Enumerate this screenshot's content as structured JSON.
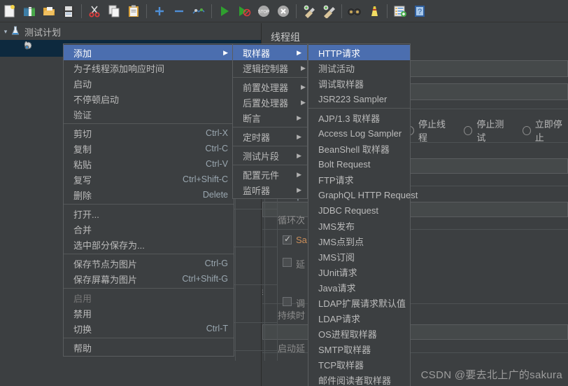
{
  "toolbar": {
    "items": [
      {
        "name": "new-icon",
        "title": "新建"
      },
      {
        "name": "templates-icon",
        "title": "模板"
      },
      {
        "name": "open-icon",
        "title": "打开"
      },
      {
        "name": "save-icon",
        "title": "保存"
      },
      {
        "name": "separator-1",
        "title": ""
      },
      {
        "name": "cut-icon",
        "title": "剪切"
      },
      {
        "name": "copy-icon",
        "title": "复制"
      },
      {
        "name": "paste-icon",
        "title": "粘贴"
      },
      {
        "name": "separator-2",
        "title": ""
      },
      {
        "name": "expand-all-icon",
        "title": "展开"
      },
      {
        "name": "collapse-all-icon",
        "title": "折叠"
      },
      {
        "name": "toggle-icon",
        "title": "切换"
      },
      {
        "name": "separator-3",
        "title": ""
      },
      {
        "name": "start-icon",
        "title": "启动"
      },
      {
        "name": "start-no-pause-icon",
        "title": "不停顿启动"
      },
      {
        "name": "stop-icon",
        "title": "停止"
      },
      {
        "name": "shutdown-icon",
        "title": "关闭"
      },
      {
        "name": "separator-4",
        "title": ""
      },
      {
        "name": "clear-icon",
        "title": "清除"
      },
      {
        "name": "clear-all-icon",
        "title": "清除全部"
      },
      {
        "name": "separator-5",
        "title": ""
      },
      {
        "name": "search-icon",
        "title": "查找"
      },
      {
        "name": "reset-search-icon",
        "title": "重置查找"
      },
      {
        "name": "separator-6",
        "title": ""
      },
      {
        "name": "function-helper-icon",
        "title": "函数助手"
      },
      {
        "name": "help-icon",
        "title": "帮助"
      }
    ]
  },
  "tree": {
    "root_label": "测试计划",
    "root_icon": "test-plan-icon",
    "child_icon": "thread-group-icon",
    "child_label": ""
  },
  "right_panel": {
    "title": "线程组",
    "strip_labels": {
      "ramp_up": "Ramp-",
      "loop_count": "循环次",
      "same_user": "Sa",
      "delay_create": "延",
      "scheduler": "调",
      "duration": "持续时",
      "startup_delay": "启动延"
    },
    "action_label_prefix": "",
    "radios": [
      {
        "label": "停止线程",
        "selected": false
      },
      {
        "label": "停止测试",
        "selected": false
      },
      {
        "label": "立即停止",
        "selected": false
      }
    ]
  },
  "menu_add": {
    "groups": [
      [
        {
          "label": "添加",
          "shortcut": "",
          "submenu": true,
          "selected": true,
          "disabled": false
        },
        {
          "label": "为子线程添加响应时间",
          "shortcut": "",
          "submenu": false,
          "selected": false,
          "disabled": false
        },
        {
          "label": "启动",
          "shortcut": "",
          "submenu": false,
          "selected": false,
          "disabled": false
        },
        {
          "label": "不停顿启动",
          "shortcut": "",
          "submenu": false,
          "selected": false,
          "disabled": false
        },
        {
          "label": "验证",
          "shortcut": "",
          "submenu": false,
          "selected": false,
          "disabled": false
        }
      ],
      [
        {
          "label": "剪切",
          "shortcut": "Ctrl-X",
          "submenu": false,
          "selected": false,
          "disabled": false
        },
        {
          "label": "复制",
          "shortcut": "Ctrl-C",
          "submenu": false,
          "selected": false,
          "disabled": false
        },
        {
          "label": "粘贴",
          "shortcut": "Ctrl-V",
          "submenu": false,
          "selected": false,
          "disabled": false
        },
        {
          "label": "复写",
          "shortcut": "Ctrl+Shift-C",
          "submenu": false,
          "selected": false,
          "disabled": false
        },
        {
          "label": "删除",
          "shortcut": "Delete",
          "submenu": false,
          "selected": false,
          "disabled": false
        }
      ],
      [
        {
          "label": "打开...",
          "shortcut": "",
          "submenu": false,
          "selected": false,
          "disabled": false
        },
        {
          "label": "合并",
          "shortcut": "",
          "submenu": false,
          "selected": false,
          "disabled": false
        },
        {
          "label": "选中部分保存为...",
          "shortcut": "",
          "submenu": false,
          "selected": false,
          "disabled": false
        }
      ],
      [
        {
          "label": "保存节点为图片",
          "shortcut": "Ctrl-G",
          "submenu": false,
          "selected": false,
          "disabled": false
        },
        {
          "label": "保存屏幕为图片",
          "shortcut": "Ctrl+Shift-G",
          "submenu": false,
          "selected": false,
          "disabled": false
        }
      ],
      [
        {
          "label": "启用",
          "shortcut": "",
          "submenu": false,
          "selected": false,
          "disabled": true
        },
        {
          "label": "禁用",
          "shortcut": "",
          "submenu": false,
          "selected": false,
          "disabled": false
        },
        {
          "label": "切换",
          "shortcut": "Ctrl-T",
          "submenu": false,
          "selected": false,
          "disabled": false
        }
      ],
      [
        {
          "label": "帮助",
          "shortcut": "",
          "submenu": false,
          "selected": false,
          "disabled": false
        }
      ]
    ]
  },
  "menu_type": {
    "groups": [
      [
        {
          "label": "取样器",
          "shortcut": "",
          "submenu": true,
          "selected": true,
          "disabled": false
        },
        {
          "label": "逻辑控制器",
          "shortcut": "",
          "submenu": true,
          "selected": false,
          "disabled": false
        }
      ],
      [
        {
          "label": "前置处理器",
          "shortcut": "",
          "submenu": true,
          "selected": false,
          "disabled": false
        },
        {
          "label": "后置处理器",
          "shortcut": "",
          "submenu": true,
          "selected": false,
          "disabled": false
        },
        {
          "label": "断言",
          "shortcut": "",
          "submenu": true,
          "selected": false,
          "disabled": false
        }
      ],
      [
        {
          "label": "定时器",
          "shortcut": "",
          "submenu": true,
          "selected": false,
          "disabled": false
        }
      ],
      [
        {
          "label": "测试片段",
          "shortcut": "",
          "submenu": true,
          "selected": false,
          "disabled": false
        }
      ],
      [
        {
          "label": "配置元件",
          "shortcut": "",
          "submenu": true,
          "selected": false,
          "disabled": false
        },
        {
          "label": "监听器",
          "shortcut": "",
          "submenu": true,
          "selected": false,
          "disabled": false
        }
      ]
    ]
  },
  "menu_sampler": {
    "groups": [
      [
        {
          "label": "HTTP请求",
          "shortcut": "",
          "submenu": false,
          "selected": true,
          "disabled": false
        },
        {
          "label": "测试活动",
          "shortcut": "",
          "submenu": false,
          "selected": false,
          "disabled": false
        },
        {
          "label": "调试取样器",
          "shortcut": "",
          "submenu": false,
          "selected": false,
          "disabled": false
        },
        {
          "label": "JSR223 Sampler",
          "shortcut": "",
          "submenu": false,
          "selected": false,
          "disabled": false
        }
      ],
      [
        {
          "label": "AJP/1.3 取样器",
          "shortcut": "",
          "submenu": false,
          "selected": false,
          "disabled": false
        },
        {
          "label": "Access Log Sampler",
          "shortcut": "",
          "submenu": false,
          "selected": false,
          "disabled": false
        },
        {
          "label": "BeanShell 取样器",
          "shortcut": "",
          "submenu": false,
          "selected": false,
          "disabled": false
        },
        {
          "label": "Bolt Request",
          "shortcut": "",
          "submenu": false,
          "selected": false,
          "disabled": false
        },
        {
          "label": "FTP请求",
          "shortcut": "",
          "submenu": false,
          "selected": false,
          "disabled": false
        },
        {
          "label": "GraphQL HTTP Request",
          "shortcut": "",
          "submenu": false,
          "selected": false,
          "disabled": false
        },
        {
          "label": "JDBC Request",
          "shortcut": "",
          "submenu": false,
          "selected": false,
          "disabled": false
        },
        {
          "label": "JMS发布",
          "shortcut": "",
          "submenu": false,
          "selected": false,
          "disabled": false
        },
        {
          "label": "JMS点到点",
          "shortcut": "",
          "submenu": false,
          "selected": false,
          "disabled": false
        },
        {
          "label": "JMS订阅",
          "shortcut": "",
          "submenu": false,
          "selected": false,
          "disabled": false
        },
        {
          "label": "JUnit请求",
          "shortcut": "",
          "submenu": false,
          "selected": false,
          "disabled": false
        },
        {
          "label": "Java请求",
          "shortcut": "",
          "submenu": false,
          "selected": false,
          "disabled": false
        },
        {
          "label": "LDAP扩展请求默认值",
          "shortcut": "",
          "submenu": false,
          "selected": false,
          "disabled": false
        },
        {
          "label": "LDAP请求",
          "shortcut": "",
          "submenu": false,
          "selected": false,
          "disabled": false
        },
        {
          "label": "OS进程取样器",
          "shortcut": "",
          "submenu": false,
          "selected": false,
          "disabled": false
        },
        {
          "label": "SMTP取样器",
          "shortcut": "",
          "submenu": false,
          "selected": false,
          "disabled": false
        },
        {
          "label": "TCP取样器",
          "shortcut": "",
          "submenu": false,
          "selected": false,
          "disabled": false
        },
        {
          "label": "邮件阅读者取样器",
          "shortcut": "",
          "submenu": false,
          "selected": false,
          "disabled": false
        }
      ]
    ]
  },
  "watermark": "CSDN @要去北上广的sakura",
  "colors": {
    "background": "#3c3f41",
    "menu_bg": "#3c3f41",
    "menu_border": "#5a5d5f",
    "highlight": "#4b6eaf",
    "text": "#bbbbbb",
    "disabled_text": "#777777",
    "shortcut_text": "#9aa7b0",
    "tree_selected": "#0d293e",
    "field_bg": "#45494a"
  }
}
